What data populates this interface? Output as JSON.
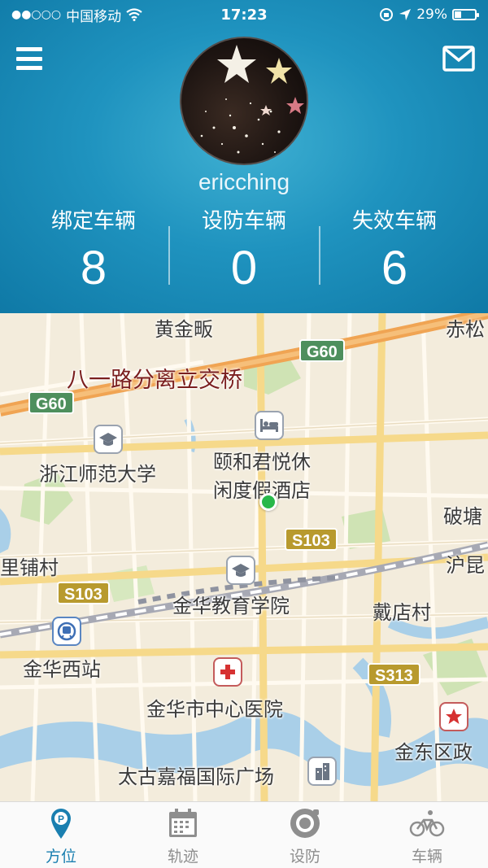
{
  "status_bar": {
    "signal": "●●○○○",
    "carrier": "中国移动",
    "time": "17:23",
    "battery_text": "29%",
    "battery_level": 0.29
  },
  "header": {
    "username": "ericching",
    "stats": [
      {
        "label": "绑定车辆",
        "value": "8"
      },
      {
        "label": "设防车辆",
        "value": "0"
      },
      {
        "label": "失效车辆",
        "value": "6"
      }
    ]
  },
  "map": {
    "labels": {
      "huangjinfan": "黄金畈",
      "chisong": "赤松",
      "bayilu": "八一路分离立交桥",
      "zjnu": "浙江师范大学",
      "hotel_1": "颐和君悦休",
      "hotel_2": "闲度假酒店",
      "potang": "破塘",
      "lipu": "里铺村",
      "hukun": "沪昆",
      "education_college": "金华教育学院",
      "daidian": "戴店村",
      "jinhua_west": "金华西站",
      "central_hospital": "金华市中心医院",
      "jindong": "金东区政",
      "taikoo": "太古嘉福国际广场"
    },
    "shields": {
      "g60_a": "G60",
      "g60_b": "G60",
      "s103_a": "S103",
      "s103_b": "S103",
      "s313": "S313"
    }
  },
  "tabs": [
    {
      "label": "方位",
      "icon": "location-pin-icon",
      "active": true
    },
    {
      "label": "轨迹",
      "icon": "calendar-icon",
      "active": false
    },
    {
      "label": "设防",
      "icon": "lock-dial-icon",
      "active": false
    },
    {
      "label": "车辆",
      "icon": "bicycle-icon",
      "active": false
    }
  ],
  "colors": {
    "header_blue": "#1f93bf",
    "active_tab": "#1a7fb0",
    "inactive_tab": "#8e8e8e",
    "location_dot": "#28b84a"
  }
}
